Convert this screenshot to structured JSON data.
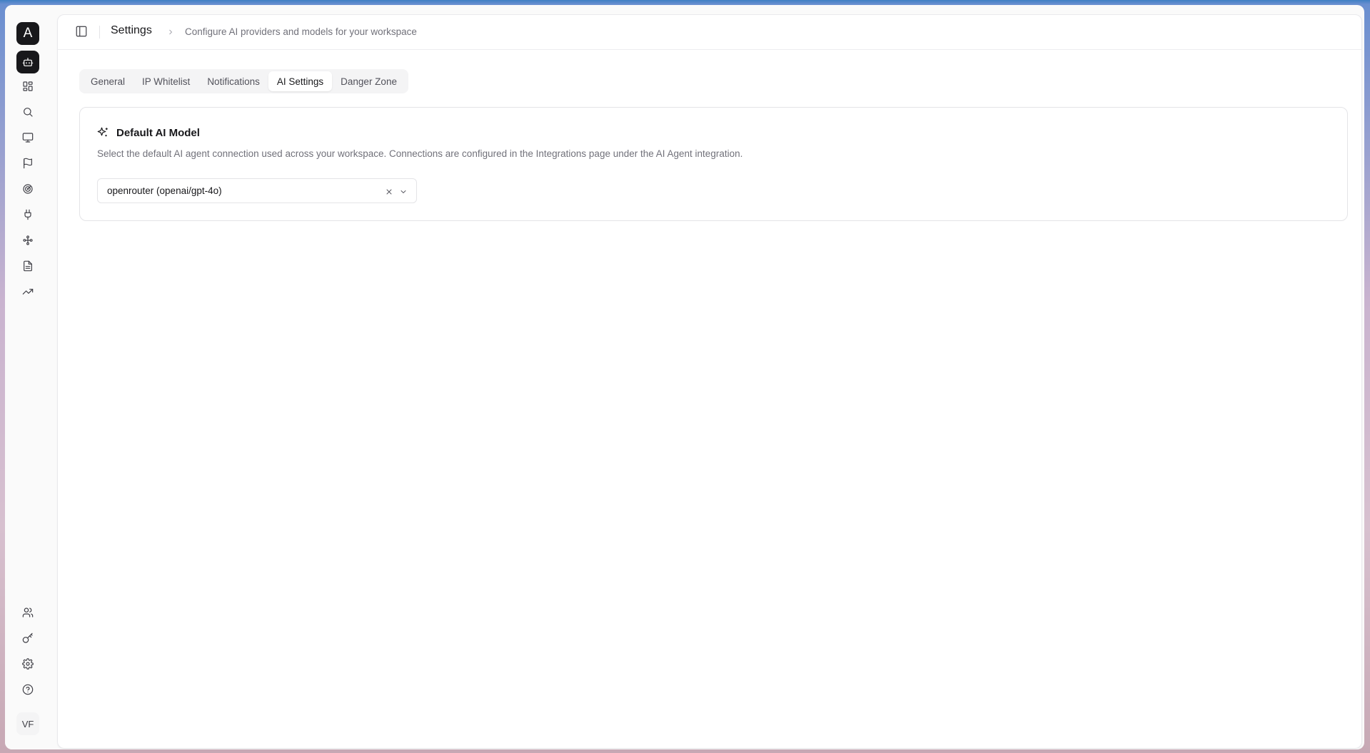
{
  "app": {
    "logo_letter": "A",
    "user_initials": "VF"
  },
  "sidebar": {
    "top_items": [
      {
        "icon": "bot-icon",
        "active": true
      },
      {
        "icon": "dashboard-icon"
      },
      {
        "icon": "search-icon"
      },
      {
        "icon": "monitor-icon"
      },
      {
        "icon": "flag-icon"
      },
      {
        "icon": "radar-icon"
      },
      {
        "icon": "plug-icon"
      },
      {
        "icon": "workflow-icon"
      },
      {
        "icon": "document-icon"
      },
      {
        "icon": "trending-up-icon"
      }
    ],
    "bottom_items": [
      {
        "icon": "users-icon"
      },
      {
        "icon": "key-icon"
      },
      {
        "icon": "settings-icon",
        "active": true
      },
      {
        "icon": "help-icon"
      }
    ]
  },
  "header": {
    "title": "Settings",
    "subtitle": "Configure AI providers and models for your workspace"
  },
  "tabs": [
    {
      "label": "General"
    },
    {
      "label": "IP Whitelist"
    },
    {
      "label": "Notifications"
    },
    {
      "label": "AI Settings",
      "active": true
    },
    {
      "label": "Danger Zone"
    }
  ],
  "card": {
    "title": "Default AI Model",
    "description": "Select the default AI agent connection used across your workspace. Connections are configured in the Integrations page under the AI Agent integration.",
    "select_value": "openrouter (openai/gpt-4o)"
  },
  "colors": {
    "accent": "#18181b",
    "muted_text": "#71717a",
    "border": "#e4e4e7"
  }
}
